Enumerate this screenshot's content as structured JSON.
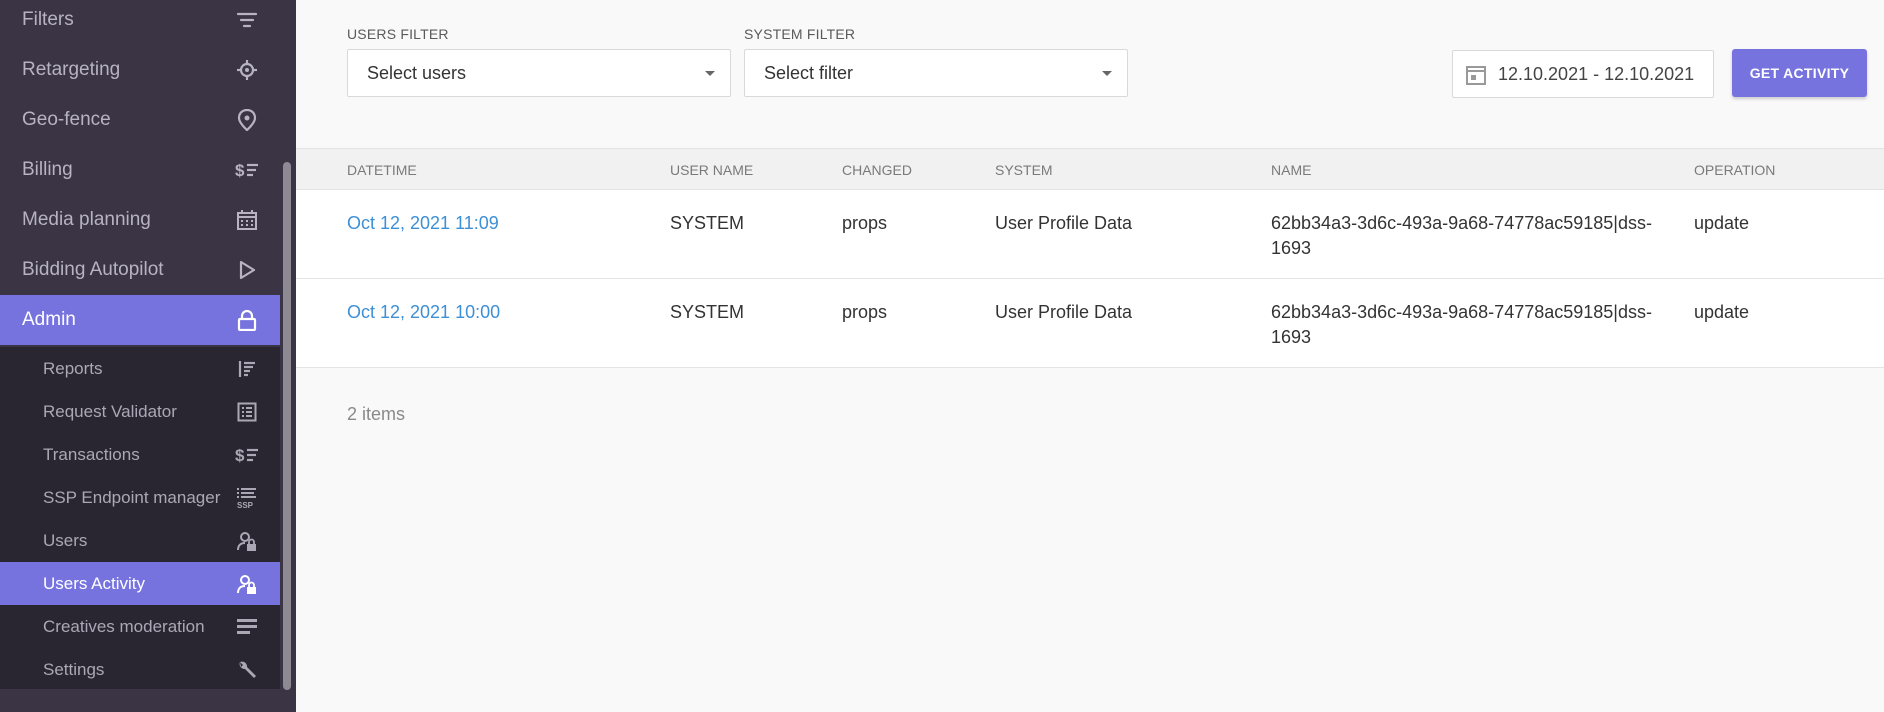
{
  "sidebar": {
    "items": [
      {
        "label": "Filters",
        "icon": "filter-icon"
      },
      {
        "label": "Retargeting",
        "icon": "crosshair-icon"
      },
      {
        "label": "Geo-fence",
        "icon": "location-pin-icon"
      },
      {
        "label": "Billing",
        "icon": "dollar-list-icon"
      },
      {
        "label": "Media planning",
        "icon": "calendar-icon"
      },
      {
        "label": "Bidding Autopilot",
        "icon": "play-icon"
      },
      {
        "label": "Admin",
        "icon": "lock-icon"
      }
    ],
    "sub_items": [
      {
        "label": "Reports",
        "icon": "reports-icon"
      },
      {
        "label": "Request Validator",
        "icon": "validator-list-icon"
      },
      {
        "label": "Transactions",
        "icon": "dollar-list-icon"
      },
      {
        "label": "SSP Endpoint manager",
        "icon": "ssp-list-icon",
        "icon_text": "SSP"
      },
      {
        "label": "Users",
        "icon": "user-lock-icon"
      },
      {
        "label": "Users Activity",
        "icon": "user-lock-icon"
      },
      {
        "label": "Creatives moderation",
        "icon": "lines-icon"
      },
      {
        "label": "Settings",
        "icon": "wrench-icon"
      }
    ],
    "active_item": "Admin",
    "active_sub_item": "Users Activity",
    "accent_color": "#7673de"
  },
  "filters": {
    "users_label": "USERS FILTER",
    "users_placeholder": "Select users",
    "system_label": "SYSTEM FILTER",
    "system_placeholder": "Select filter",
    "date_range": "12.10.2021 - 12.10.2021",
    "get_activity_label": "GET ACTIVITY"
  },
  "table": {
    "columns": [
      "DATETIME",
      "USER NAME",
      "CHANGED",
      "SYSTEM",
      "NAME",
      "OPERATION"
    ],
    "rows": [
      {
        "datetime": "Oct 12, 2021 11:09",
        "user_name": "SYSTEM",
        "changed": "props",
        "system": "User Profile Data",
        "name_line1": "62bb34a3-3d6c-493a-9a68-74778ac59185|dss-",
        "name_line2": "1693",
        "operation": "update"
      },
      {
        "datetime": "Oct 12, 2021 10:00",
        "user_name": "SYSTEM",
        "changed": "props",
        "system": "User Profile Data",
        "name_line1": "62bb34a3-3d6c-493a-9a68-74778ac59185|dss-",
        "name_line2": "1693",
        "operation": "update"
      }
    ],
    "items_count": "2 items"
  }
}
